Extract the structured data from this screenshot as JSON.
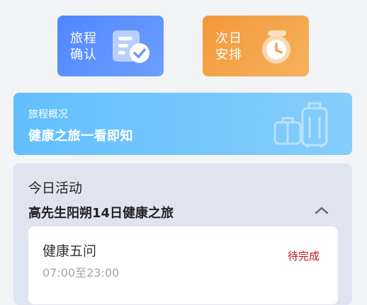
{
  "quick_actions": {
    "confirm": {
      "line1": "旅程",
      "line2": "确认",
      "icon": "checklist-icon"
    },
    "next_day": {
      "line1": "次日",
      "line2": "安排",
      "icon": "timer-icon"
    }
  },
  "overview": {
    "subtitle": "旅程概况",
    "title": "健康之旅一看即知",
    "icon": "luggage-icon"
  },
  "today": {
    "heading": "今日活动",
    "trip_name": "高先生阳朔14日健康之旅",
    "collapse_icon": "chevron-up-icon",
    "activity": {
      "name": "健康五问",
      "time": "07:00至23:00",
      "status": "待完成"
    }
  },
  "colors": {
    "confirm_tile": "#4f86ff",
    "next_tile": "#f3983a",
    "overview_card": "#62bffd",
    "today_panel": "#dfe4f1",
    "status_pending": "#c0141c"
  }
}
